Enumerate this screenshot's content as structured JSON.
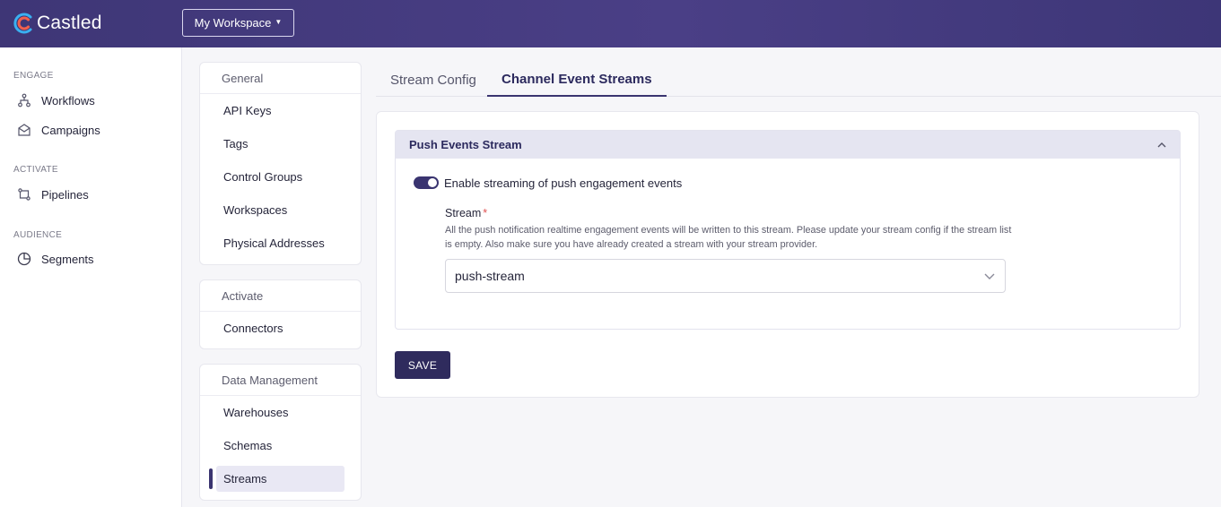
{
  "brand": {
    "name": "Castled",
    "accent": "#3a3470",
    "header_color": "#433b7e"
  },
  "header": {
    "workspace_button": "My Workspace"
  },
  "leftnav": {
    "sections": [
      {
        "title": "ENGAGE",
        "items": [
          {
            "label": "Workflows",
            "icon": "workflow-icon"
          },
          {
            "label": "Campaigns",
            "icon": "campaign-icon"
          }
        ]
      },
      {
        "title": "ACTIVATE",
        "items": [
          {
            "label": "Pipelines",
            "icon": "pipeline-icon"
          }
        ]
      },
      {
        "title": "AUDIENCE",
        "items": [
          {
            "label": "Segments",
            "icon": "segments-icon"
          }
        ]
      }
    ]
  },
  "settings": {
    "general": {
      "title": "General",
      "items": [
        "API Keys",
        "Tags",
        "Control Groups",
        "Workspaces",
        "Physical Addresses"
      ]
    },
    "activate": {
      "title": "Activate",
      "items": [
        "Connectors"
      ]
    },
    "data_management": {
      "title": "Data Management",
      "items": [
        "Warehouses",
        "Schemas",
        "Streams"
      ],
      "active": "Streams"
    }
  },
  "tabs": [
    {
      "label": "Stream Config",
      "active": false
    },
    {
      "label": "Channel Event Streams",
      "active": true
    }
  ],
  "push_stream": {
    "title": "Push Events Stream",
    "toggle_label": "Enable streaming of push engagement events",
    "toggle_on": true,
    "stream_label": "Stream",
    "required_mark": "*",
    "help_text": "All the push notification realtime engagement events will be written to this stream. Please update your stream config if the stream list is empty. Also make sure you have already created a stream with your stream provider.",
    "selected_stream": "push-stream"
  },
  "actions": {
    "save": "SAVE"
  }
}
